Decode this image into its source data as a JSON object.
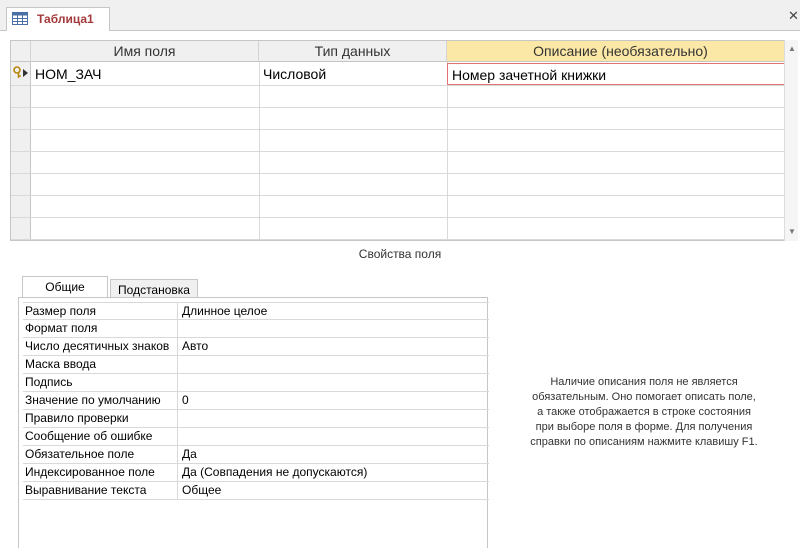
{
  "document_tab": {
    "title": "Таблица1"
  },
  "grid": {
    "columns": [
      "Имя поля",
      "Тип данных",
      "Описание (необязательно)"
    ],
    "rows": [
      {
        "field_name": "НОМ_ЗАЧ",
        "data_type": "Числовой",
        "description": "Номер зачетной книжки"
      }
    ]
  },
  "field_properties": {
    "caption": "Свойства поля",
    "tabs": [
      "Общие",
      "Подстановка"
    ],
    "active_tab": "Общие",
    "rows": [
      {
        "name": "Размер поля",
        "value": "Длинное целое"
      },
      {
        "name": "Формат поля",
        "value": ""
      },
      {
        "name": "Число десятичных знаков",
        "value": "Авто"
      },
      {
        "name": "Маска ввода",
        "value": ""
      },
      {
        "name": "Подпись",
        "value": ""
      },
      {
        "name": "Значение по умолчанию",
        "value": "0"
      },
      {
        "name": "Правило проверки",
        "value": ""
      },
      {
        "name": "Сообщение об ошибке",
        "value": ""
      },
      {
        "name": "Обязательное поле",
        "value": "Да"
      },
      {
        "name": "Индексированное поле",
        "value": "Да (Совпадения не допускаются)"
      },
      {
        "name": "Выравнивание текста",
        "value": "Общее"
      }
    ]
  },
  "help_text": [
    "Наличие описания поля не является",
    "обязательным. Оно помогает описать поле,",
    "а также отображается в строке состояния",
    "при выборе поля в форме. Для получения",
    "справки по описаниям нажмите клавишу F1."
  ],
  "colors": {
    "active_header": "#fce8a6",
    "tab_label": "#a33a3a",
    "edit_border": "#e27272"
  }
}
